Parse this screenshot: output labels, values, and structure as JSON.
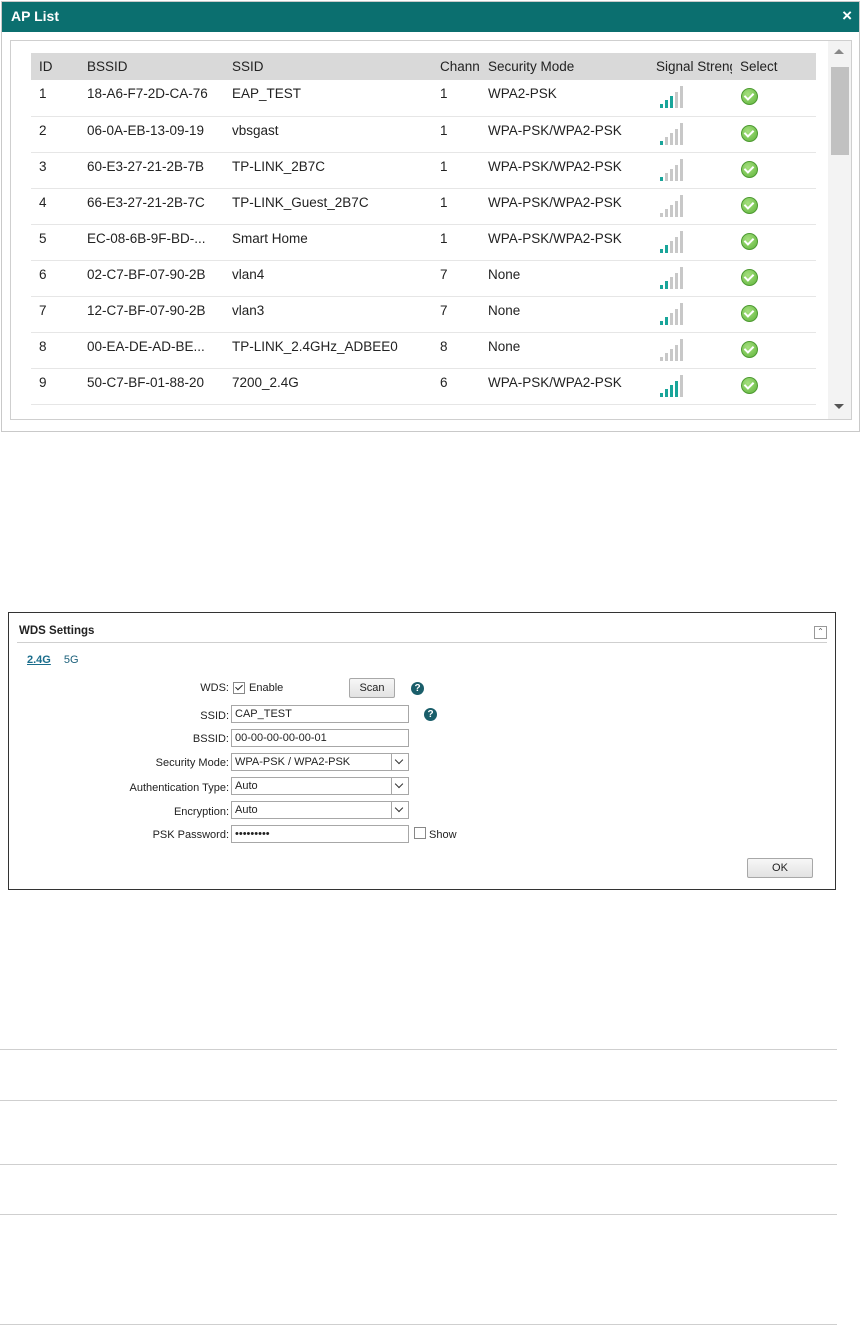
{
  "ap_list": {
    "title": "AP List",
    "close_symbol": "×",
    "columns": [
      "ID",
      "BSSID",
      "SSID",
      "Channel",
      "Security Mode",
      "Signal Strength",
      "Select"
    ],
    "rows": [
      {
        "id": "1",
        "bssid": "18-A6-F7-2D-CA-76",
        "ssid": "EAP_TEST",
        "channel": "1",
        "security": "WPA2-PSK",
        "signal": 3
      },
      {
        "id": "2",
        "bssid": "06-0A-EB-13-09-19",
        "ssid": "vbsgast",
        "channel": "1",
        "security": "WPA-PSK/WPA2-PSK",
        "signal": 1
      },
      {
        "id": "3",
        "bssid": "60-E3-27-21-2B-7B",
        "ssid": "TP-LINK_2B7C",
        "channel": "1",
        "security": "WPA-PSK/WPA2-PSK",
        "signal": 1
      },
      {
        "id": "4",
        "bssid": "66-E3-27-21-2B-7C",
        "ssid": "TP-LINK_Guest_2B7C",
        "channel": "1",
        "security": "WPA-PSK/WPA2-PSK",
        "signal": 0
      },
      {
        "id": "5",
        "bssid": "EC-08-6B-9F-BD-...",
        "ssid": "Smart Home",
        "channel": "1",
        "security": "WPA-PSK/WPA2-PSK",
        "signal": 2
      },
      {
        "id": "6",
        "bssid": "02-C7-BF-07-90-2B",
        "ssid": "vlan4",
        "channel": "7",
        "security": "None",
        "signal": 2
      },
      {
        "id": "7",
        "bssid": "12-C7-BF-07-90-2B",
        "ssid": "vlan3",
        "channel": "7",
        "security": "None",
        "signal": 2
      },
      {
        "id": "8",
        "bssid": "00-EA-DE-AD-BE...",
        "ssid": "TP-LINK_2.4GHz_ADBEE0",
        "channel": "8",
        "security": "None",
        "signal": 0
      },
      {
        "id": "9",
        "bssid": "50-C7-BF-01-88-20",
        "ssid": "7200_2.4G",
        "channel": "6",
        "security": "WPA-PSK/WPA2-PSK",
        "signal": 4
      }
    ],
    "colors": {
      "title_bar": "#0b6f6f",
      "signal_on": "#19a59a",
      "signal_off": "#c8c8c8"
    }
  },
  "wds": {
    "title": "WDS Settings",
    "tabs": [
      {
        "label": "2.4G",
        "active": true
      },
      {
        "label": "5G",
        "active": false
      }
    ],
    "wds_label": "WDS:",
    "enable_label": "Enable",
    "enable_checked": true,
    "scan_label": "Scan",
    "ssid_label": "SSID:",
    "ssid_value": "CAP_TEST",
    "bssid_label": "BSSID:",
    "bssid_value": "00-00-00-00-00-01",
    "security_label": "Security Mode:",
    "security_value": "WPA-PSK / WPA2-PSK",
    "auth_label": "Authentication Type:",
    "auth_value": "Auto",
    "encryption_label": "Encryption:",
    "encryption_value": "Auto",
    "psk_label": "PSK Password:",
    "psk_value": "•••••••••",
    "show_label": "Show",
    "show_checked": false,
    "ok_label": "OK",
    "help_symbol": "?"
  }
}
